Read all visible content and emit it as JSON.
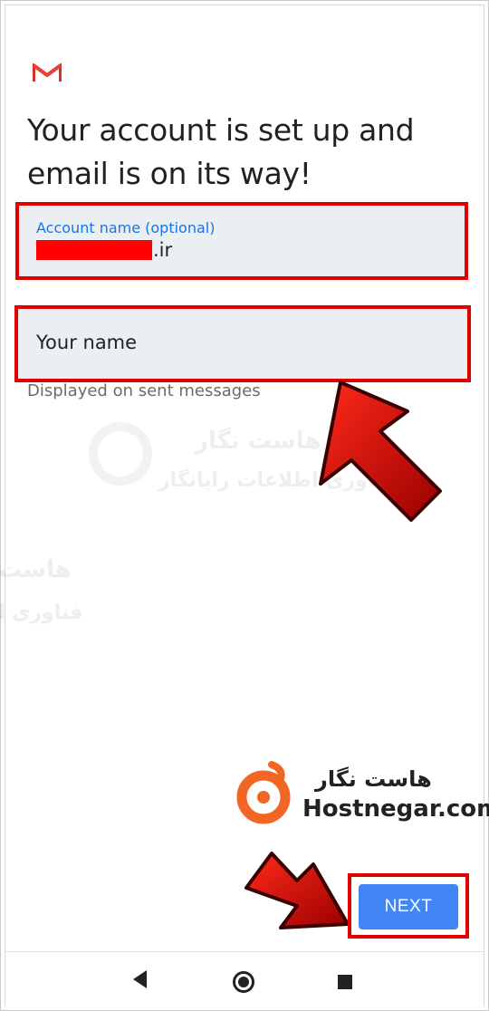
{
  "screen": {
    "headline": "Your account is set up and email is on its way!"
  },
  "account_field": {
    "label": "Account name (optional)",
    "value_suffix": ".ir"
  },
  "name_field": {
    "placeholder": "Your name",
    "helper": "Displayed on sent messages"
  },
  "watermark": {
    "line1": "هاست نگار",
    "line2": "فناوری اطلاعات رایانگار",
    "edge_line1": "هاست",
    "edge_line2": "فناوری ا"
  },
  "branding": {
    "name_fa": "هاست نگار",
    "name_en": "Hostnegar.com"
  },
  "actions": {
    "next_label": "NEXT"
  },
  "nav": {
    "back_icon": "back-triangle",
    "home_icon": "home-circle",
    "recents_icon": "recents-square"
  },
  "colors": {
    "accent_blue": "#4285f4",
    "label_blue": "#1a73e8",
    "highlight_red": "#e00000",
    "field_bg": "#eceff1",
    "brand_orange": "#f26522"
  }
}
